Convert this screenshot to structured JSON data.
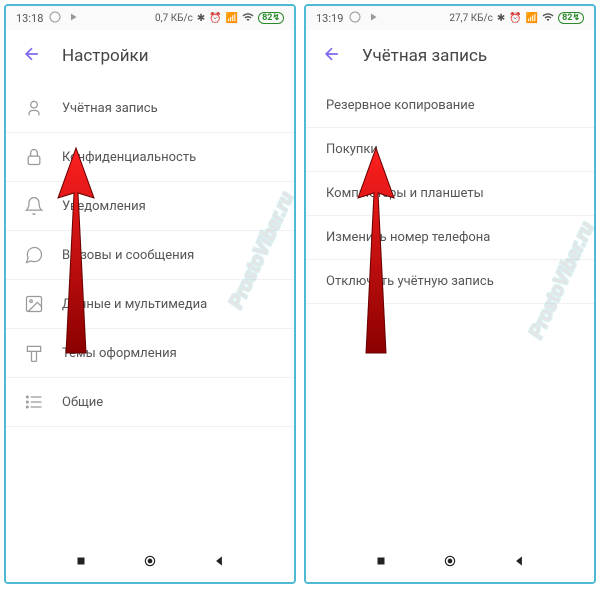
{
  "left": {
    "status": {
      "time": "13:18",
      "data_rate": "0,7 КБ/с",
      "battery": "82"
    },
    "header": {
      "title": "Настройки"
    },
    "menu": [
      {
        "label": "Учётная запись",
        "icon": "user-icon"
      },
      {
        "label": "Конфиденциальность",
        "icon": "lock-icon"
      },
      {
        "label": "Уведомления",
        "icon": "bell-icon"
      },
      {
        "label": "Вызовы и сообщения",
        "icon": "chat-icon"
      },
      {
        "label": "Данные и мультимедиа",
        "icon": "image-icon"
      },
      {
        "label": "Темы оформления",
        "icon": "brush-icon"
      },
      {
        "label": "Общие",
        "icon": "list-icon"
      }
    ]
  },
  "right": {
    "status": {
      "time": "13:19",
      "data_rate": "27,7 КБ/с",
      "battery": "82"
    },
    "header": {
      "title": "Учётная запись"
    },
    "menu": [
      {
        "label": "Резервное копирование"
      },
      {
        "label": "Покупки"
      },
      {
        "label": "Компьютеры и планшеты"
      },
      {
        "label": "Изменить номер телефона"
      },
      {
        "label": "Отключить учётную запись"
      }
    ]
  },
  "watermark": "ProstoViber.ru"
}
